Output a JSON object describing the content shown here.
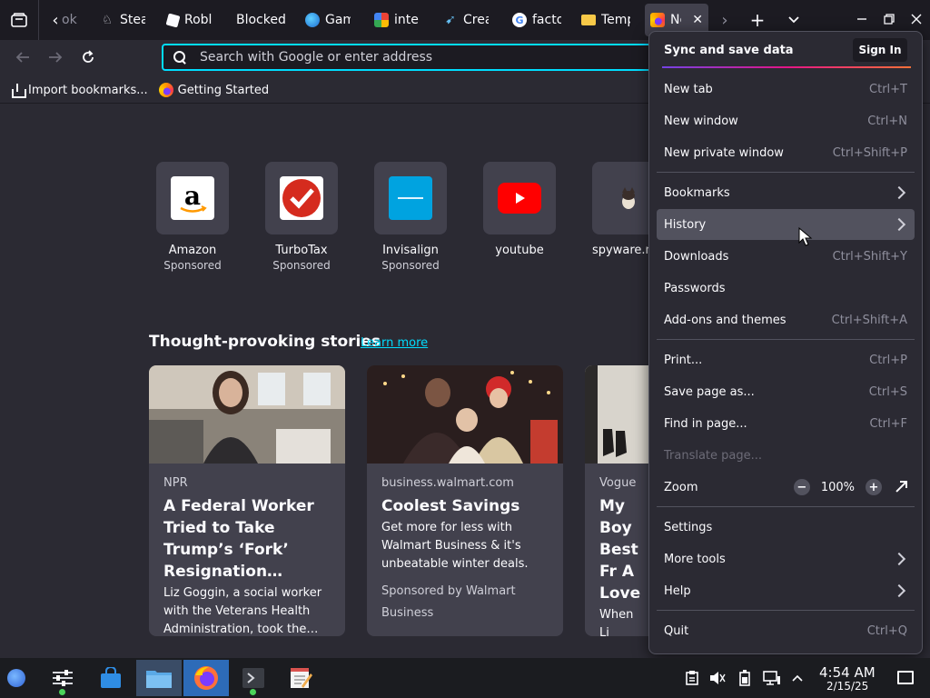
{
  "tabs": [
    {
      "label": "ok",
      "icon": "google-icon"
    },
    {
      "label": "Stear",
      "icon": "steam-icon"
    },
    {
      "label": "Robl",
      "icon": "roblox-icon"
    },
    {
      "label": "Blocked",
      "icon": ""
    },
    {
      "label": "Gam",
      "icon": "globe-icon"
    },
    {
      "label": "intel",
      "icon": "intel-icon"
    },
    {
      "label": "Creat",
      "icon": "steam-icon"
    },
    {
      "label": "facto",
      "icon": "google-icon"
    },
    {
      "label": "Temp",
      "icon": "mail-icon"
    },
    {
      "label": "Ne",
      "icon": "firefox-icon",
      "active": true
    }
  ],
  "urlbar": {
    "placeholder": "Search with Google or enter address"
  },
  "bookmarks": [
    {
      "label": "Import bookmarks...",
      "icon": "import-icon"
    },
    {
      "label": "Getting Started",
      "icon": "firefox-icon"
    }
  ],
  "top_sites": [
    {
      "title": "Amazon",
      "sponsored": "Sponsored",
      "logo": "amazon-logo"
    },
    {
      "title": "TurboTax",
      "sponsored": "Sponsored",
      "logo": "turbotax-logo"
    },
    {
      "title": "Invisalign",
      "sponsored": "Sponsored",
      "logo": "invisalign-logo"
    },
    {
      "title": "youtube",
      "sponsored": "",
      "logo": "youtube-logo"
    },
    {
      "title": "spyware.ne",
      "sponsored": "",
      "logo": "dog-logo"
    }
  ],
  "stories": {
    "heading": "Thought-provoking stories",
    "learn_more": "Learn more",
    "cards": [
      {
        "source": "NPR",
        "headline": "A Federal Worker Tried to Take Trump’s ‘Fork’ Resignation…",
        "excerpt": "Liz Goggin, a social worker with the Veterans Health Administration, took the…",
        "sponsor": ""
      },
      {
        "source": "business.walmart.com",
        "headline": "Coolest Savings",
        "excerpt": "Get more for less with Walmart Business & it's unbeatable winter deals.",
        "sponsor": "Sponsored by Walmart Business"
      },
      {
        "source": "Vogue",
        "headline": "My Boy Best Fr A Love",
        "excerpt": "When Li boyfrien caused a",
        "sponsor": ""
      }
    ]
  },
  "menu": {
    "sync_title": "Sync and save data",
    "sign_in": "Sign In",
    "items": [
      {
        "label": "New tab",
        "shortcut": "Ctrl+T"
      },
      {
        "label": "New window",
        "shortcut": "Ctrl+N"
      },
      {
        "label": "New private window",
        "shortcut": "Ctrl+Shift+P"
      },
      {
        "label": "Bookmarks",
        "shortcut": ""
      },
      {
        "label": "History",
        "shortcut": ""
      },
      {
        "label": "Downloads",
        "shortcut": "Ctrl+Shift+Y"
      },
      {
        "label": "Passwords",
        "shortcut": ""
      },
      {
        "label": "Add-ons and themes",
        "shortcut": "Ctrl+Shift+A"
      },
      {
        "label": "Print...",
        "shortcut": "Ctrl+P"
      },
      {
        "label": "Save page as...",
        "shortcut": "Ctrl+S"
      },
      {
        "label": "Find in page...",
        "shortcut": "Ctrl+F"
      },
      {
        "label": "Translate page...",
        "shortcut": ""
      },
      {
        "label": "Zoom",
        "shortcut": ""
      },
      {
        "label": "Settings",
        "shortcut": ""
      },
      {
        "label": "More tools",
        "shortcut": ""
      },
      {
        "label": "Help",
        "shortcut": ""
      },
      {
        "label": "Quit",
        "shortcut": "Ctrl+Q"
      }
    ],
    "zoom": {
      "minus": "−",
      "value": "100%",
      "plus": "+"
    }
  },
  "taskbar": {
    "time": "4:54 AM",
    "date": "2/15/25"
  },
  "colors": {
    "accent": "#00ddff",
    "background": "#2b2a33",
    "toolbar": "#1c1b22",
    "card": "#42414d"
  }
}
